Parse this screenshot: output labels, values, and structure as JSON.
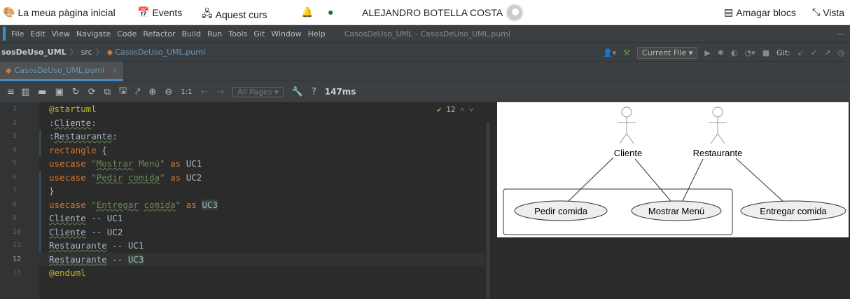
{
  "moodle": {
    "home_label": "La meua pàgina inicial",
    "events_label": "Events",
    "course_label": "Aquest curs",
    "user_name": "ALEJANDRO BOTELLA COSTA",
    "hide_blocks_label": "Amagar blocs",
    "view_label": "Vista"
  },
  "menu": {
    "items": [
      "File",
      "Edit",
      "View",
      "Navigate",
      "Code",
      "Refactor",
      "Build",
      "Run",
      "Tools",
      "Git",
      "Window",
      "Help"
    ],
    "project_title": "CasosDeUso_UML - CasosDeUso_UML.puml"
  },
  "navbar": {
    "project": "sosDeUso_UML",
    "folder": "src",
    "file": "CasosDeUso_UML.puml",
    "run_config": "Current File",
    "git_label": "Git:"
  },
  "tab": {
    "label": "CasosDeUso_UML.puml"
  },
  "toolbar": {
    "scale_label": "1:1",
    "pages_label": "All Pages",
    "help_label": "?",
    "render_time": "147ms"
  },
  "editor": {
    "inspection_count": "12",
    "current_line": 12,
    "line_numbers": [
      "1",
      "2",
      "3",
      "4",
      "5",
      "6",
      "7",
      "8",
      "9",
      "10",
      "11",
      "12",
      "13"
    ]
  },
  "diagram": {
    "actors": [
      "Cliente",
      "Restaurante"
    ],
    "usecases_in_rect": [
      "Pedir comida",
      "Mostrar Menú"
    ],
    "usecase_outside": "Entregar comida"
  },
  "colors": {
    "keyword": "#cc7832",
    "string": "#6a8759",
    "directive": "#bbb529",
    "text": "#a9b7c6"
  }
}
